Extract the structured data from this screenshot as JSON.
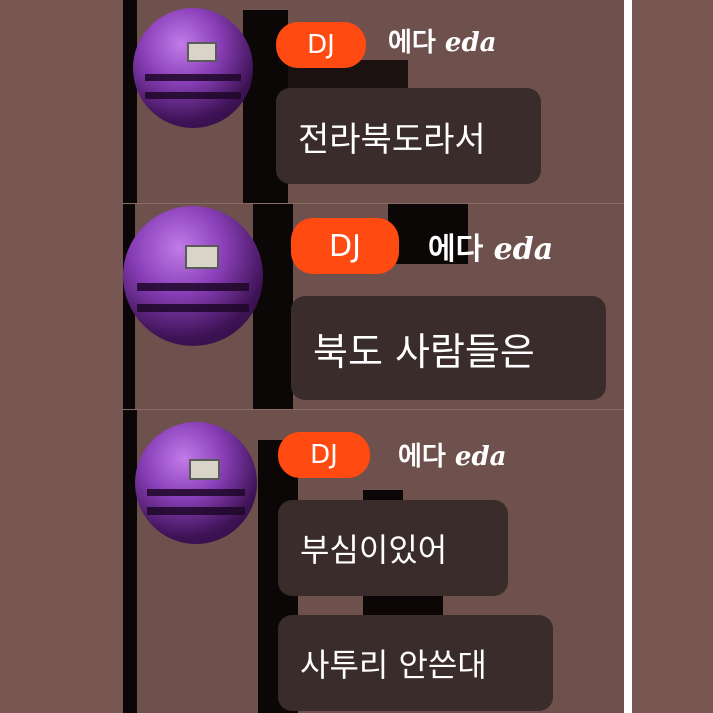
{
  "messages": [
    {
      "badge": "DJ",
      "sender": "에다",
      "sender_latin": "eda",
      "text": "전라북도라서"
    },
    {
      "badge": "DJ",
      "sender": "에다",
      "sender_latin": "eda",
      "text": "북도 사람들은"
    },
    {
      "badge": "DJ",
      "sender": "에다",
      "sender_latin": "eda",
      "text": "부심이있어",
      "text2": "사투리 안쓴대"
    }
  ],
  "colors": {
    "badge": "#ff4a12",
    "bubble": "#3a2c2a",
    "background": "#785752"
  }
}
